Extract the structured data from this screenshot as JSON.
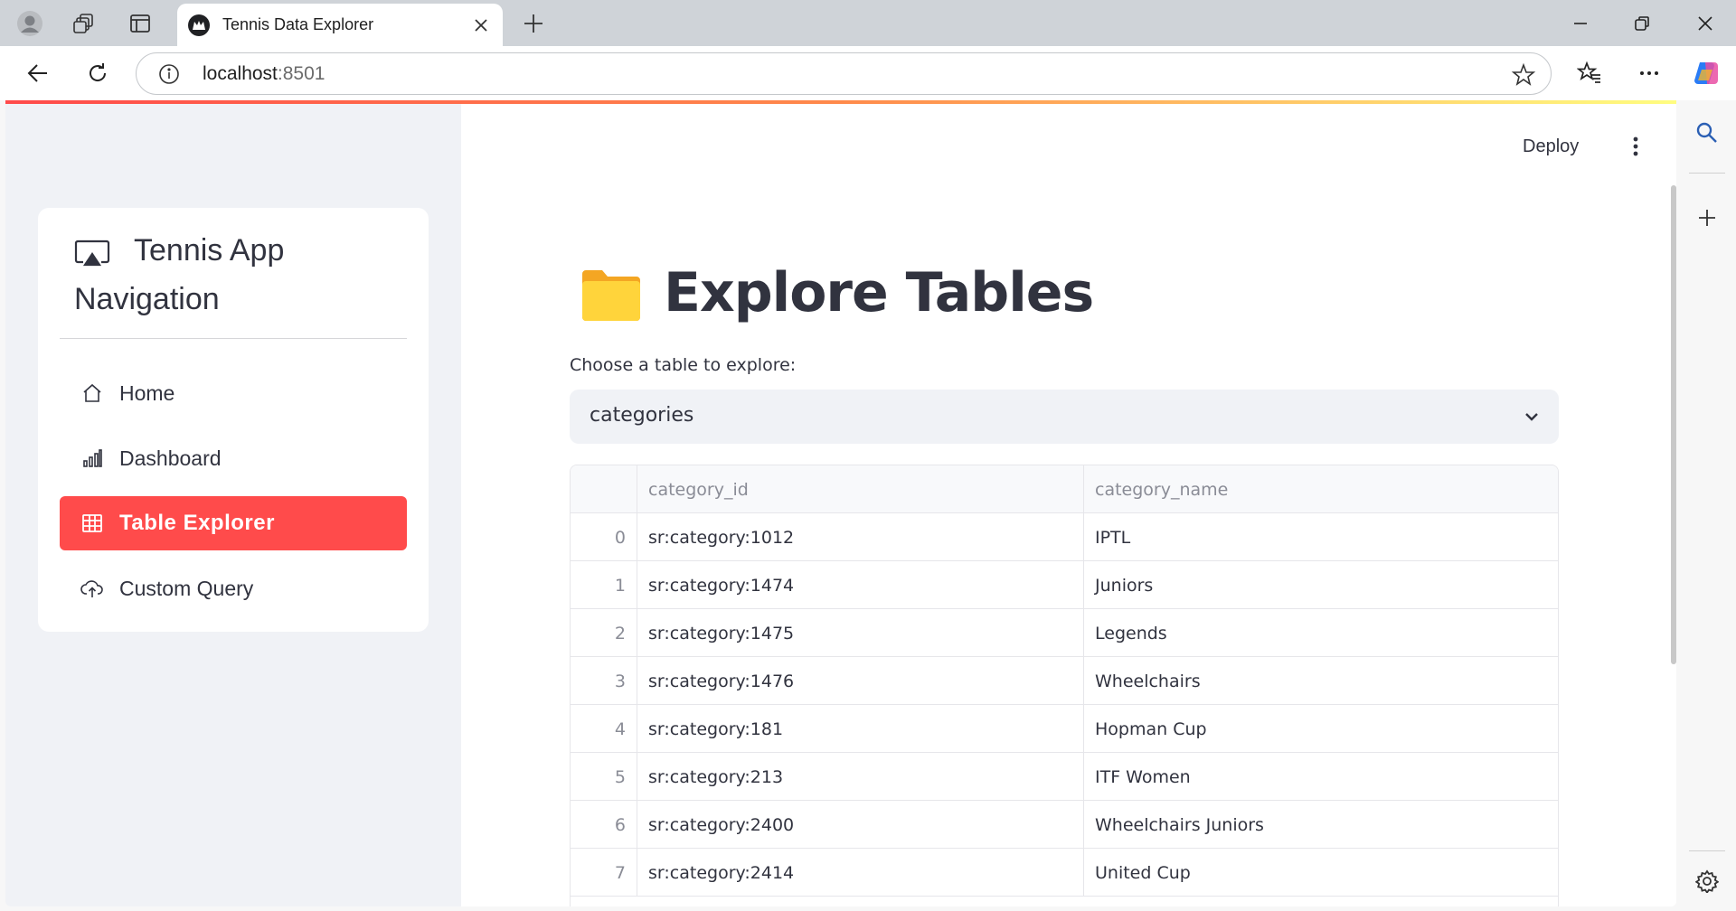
{
  "browser": {
    "tab_title": "Tennis Data Explorer",
    "url_host": "localhost",
    "url_port": ":8501"
  },
  "app": {
    "deploy_label": "Deploy"
  },
  "sidebar": {
    "title_line1": "Tennis App",
    "title_line2": "Navigation",
    "items": [
      {
        "label": "Home",
        "icon": "home-icon",
        "active": false
      },
      {
        "label": "Dashboard",
        "icon": "bar-chart-icon",
        "active": false
      },
      {
        "label": "Table Explorer",
        "icon": "table-icon",
        "active": true
      },
      {
        "label": "Custom Query",
        "icon": "cloud-upload-icon",
        "active": false
      }
    ]
  },
  "main": {
    "title": "Explore Tables",
    "title_icon": "folder-icon",
    "select_label": "Choose a table to explore:",
    "selected_table": "categories",
    "table": {
      "columns": [
        "category_id",
        "category_name"
      ],
      "rows": [
        {
          "index": "0",
          "category_id": "sr:category:1012",
          "category_name": "IPTL"
        },
        {
          "index": "1",
          "category_id": "sr:category:1474",
          "category_name": "Juniors"
        },
        {
          "index": "2",
          "category_id": "sr:category:1475",
          "category_name": "Legends"
        },
        {
          "index": "3",
          "category_id": "sr:category:1476",
          "category_name": "Wheelchairs"
        },
        {
          "index": "4",
          "category_id": "sr:category:181",
          "category_name": "Hopman Cup"
        },
        {
          "index": "5",
          "category_id": "sr:category:213",
          "category_name": "ITF Women"
        },
        {
          "index": "6",
          "category_id": "sr:category:2400",
          "category_name": "Wheelchairs Juniors"
        },
        {
          "index": "7",
          "category_id": "sr:category:2414",
          "category_name": "United Cup"
        }
      ]
    }
  },
  "colors": {
    "accent": "#ff4b4b",
    "sidebar_bg": "#f0f2f6",
    "text": "#31333f"
  }
}
